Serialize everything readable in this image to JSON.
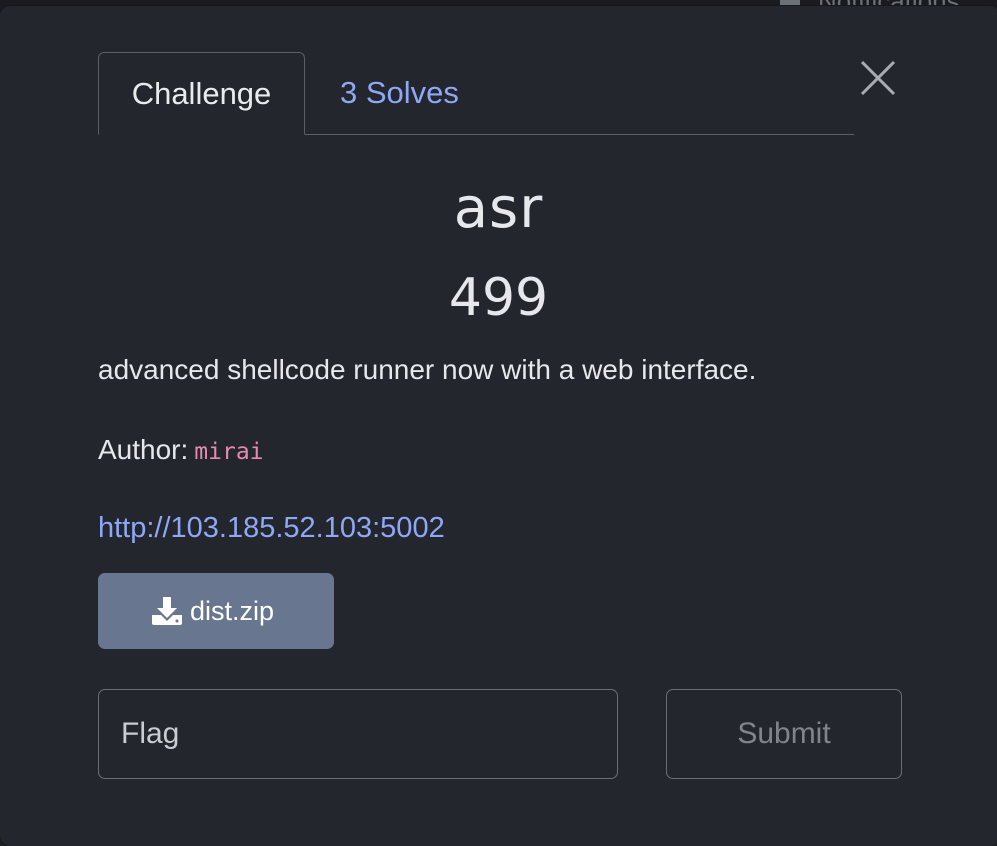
{
  "background": {
    "notifications_label": "Notifications"
  },
  "tabs": [
    {
      "label": "Challenge",
      "active": true
    },
    {
      "label": "3 Solves",
      "active": false
    }
  ],
  "challenge": {
    "name": "asr",
    "points": "499",
    "description": "advanced shellcode runner now with a web interface.",
    "author_label": "Author:",
    "author_name": "mirai",
    "link": "http://103.185.52.103:5002",
    "file_button": "dist.zip",
    "file_icon": "download-icon"
  },
  "form": {
    "flag_placeholder": "Flag",
    "flag_value": "",
    "submit_label": "Submit"
  },
  "colors": {
    "accent": "#8ea8f5",
    "button": "#68778f",
    "code": "#e68ab4",
    "side_accent": "#4f8a3e"
  }
}
